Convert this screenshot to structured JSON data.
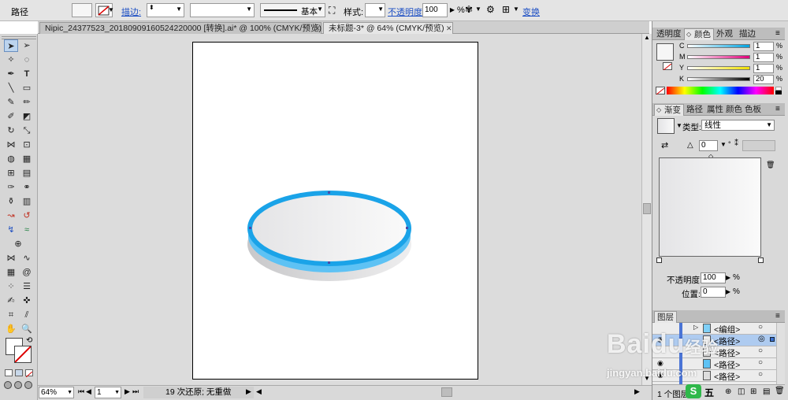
{
  "control_bar": {
    "object_label": "路径",
    "stroke_label": "描边:",
    "stroke_profile": "基本",
    "style_label": "样式:",
    "opacity_label": "不透明度:",
    "opacity_value": "100",
    "opacity_unit": "%",
    "transform_link": "变换"
  },
  "tabs": [
    {
      "label": "Nipic_24377523_20180909160524220000  [转换].ai* @ 100% (CMYK/预览)"
    },
    {
      "label": "未标题-3* @ 64% (CMYK/预览)"
    }
  ],
  "tools": {
    "reset_label": "⟲"
  },
  "status_bar": {
    "zoom": "64%",
    "page": "1",
    "undo_info": "19 次还原; 无重做"
  },
  "color_panel": {
    "tabs": [
      "透明度",
      "颜色",
      "外观",
      "描边"
    ],
    "channels": [
      {
        "name": "C",
        "value": "1"
      },
      {
        "name": "M",
        "value": "1"
      },
      {
        "name": "Y",
        "value": "1"
      },
      {
        "name": "K",
        "value": "20"
      }
    ]
  },
  "gradient_panel": {
    "tabs": [
      "渐变",
      "路径",
      "属性",
      "颜色",
      "色板"
    ],
    "type_label": "类型:",
    "type_value": "线性",
    "angle_value": "0",
    "angle_unit": "°",
    "opacity_label": "不透明度:",
    "opacity_value": "100",
    "opacity_unit": "%",
    "position_label": "位置:",
    "position_value": "0",
    "position_unit": "%"
  },
  "layers_panel": {
    "tab": "图层",
    "rows": [
      {
        "name": "<编组>"
      },
      {
        "name": "<路径>"
      },
      {
        "name": "<路径>"
      },
      {
        "name": "<路径>"
      },
      {
        "name": "<路径>"
      }
    ],
    "count_label": "1 个图层"
  },
  "watermark": {
    "brand": "Baidu",
    "brand_suffix": "经验",
    "url": "jingyan.baidu.com",
    "brand_cn": "五"
  },
  "colors": {
    "accent_blue": "#1aa3e8",
    "ui_gray": "#d9d9d9",
    "canvas_gray": "#dcdcdc"
  }
}
